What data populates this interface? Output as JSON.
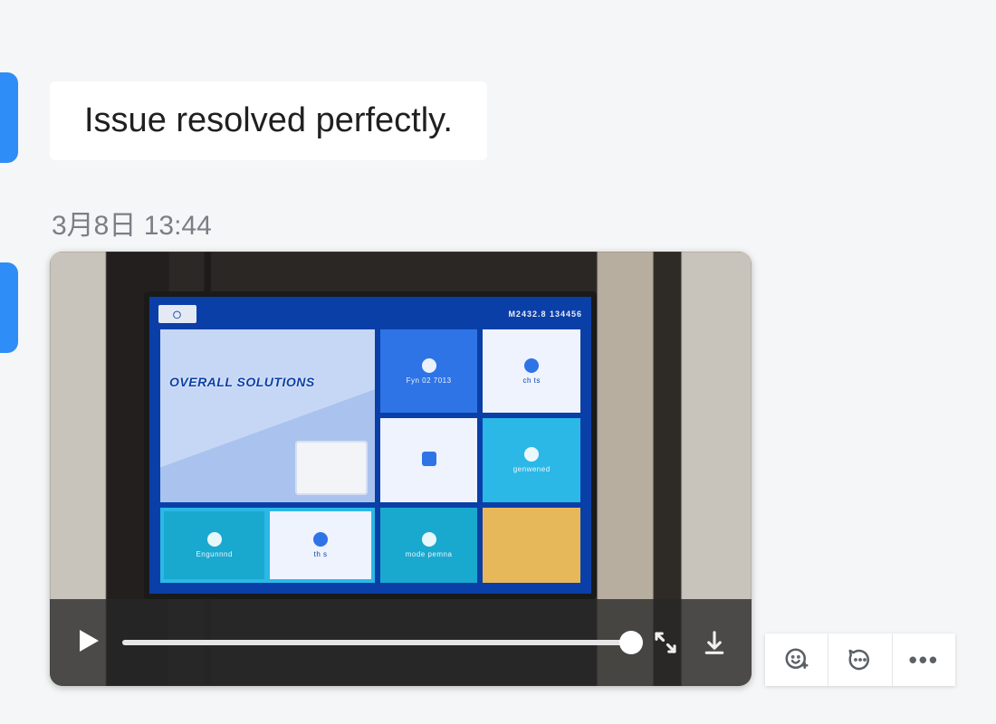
{
  "message": {
    "text": "Issue resolved perfectly."
  },
  "timestamp": "3月8日 13:44",
  "video": {
    "screen": {
      "header_left_text": "",
      "header_right_text": "M2432.8  134456",
      "hero_brand": "OVERALL SOLUTIONS",
      "tiles": {
        "t1_label": "Fyn 02 7013",
        "t2_label": "ch ts",
        "t3_label": "",
        "t4_label": "genwened",
        "r3a_left": "Engunnnd",
        "r3a_right": "th s",
        "r3b_label": "mode pemna",
        "r3c_label": ""
      }
    },
    "progress_pct": 100
  },
  "icons": {
    "play": "play-icon",
    "fullscreen": "fullscreen-icon",
    "download": "download-icon",
    "react_emoji": "emoji-add-icon",
    "react_comment": "comment-icon",
    "react_more": "more-icon"
  }
}
